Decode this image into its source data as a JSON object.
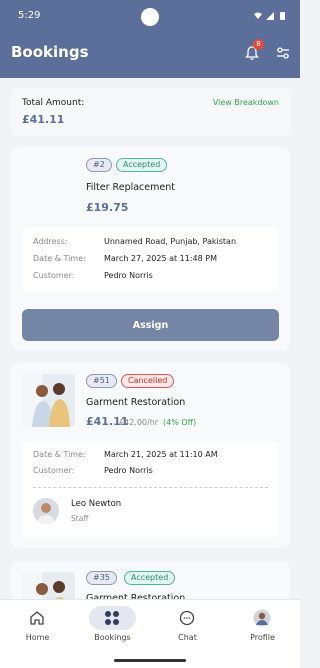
{
  "status": {
    "time": "5:29"
  },
  "header": {
    "title": "Bookings",
    "notification_count": "8"
  },
  "summary": {
    "label": "Total Amount:",
    "value": "£41.11",
    "link": "View Breakdown"
  },
  "bookings": [
    {
      "id": "#2",
      "status": "Accepted",
      "service": "Filter Replacement",
      "price": "£19.75",
      "details": [
        {
          "label": "Address:",
          "value": "Unnamed Road, Punjab, Pakistan"
        },
        {
          "label": "Date & Time:",
          "value": "March 27, 2025 at 11:48 PM"
        },
        {
          "label": "Customer:",
          "value": "Pedro Norris"
        }
      ],
      "action": "Assign"
    },
    {
      "id": "#51",
      "status": "Cancelled",
      "service": "Garment Restoration",
      "price": "£41.11",
      "old_price": "£42.00/hr",
      "discount": "(4% Off)",
      "details": [
        {
          "label": "Date & Time:",
          "value": "March 21, 2025 at 11:10 AM"
        },
        {
          "label": "Customer:",
          "value": "Pedro Norris"
        }
      ],
      "staff": {
        "name": "Leo Newton",
        "role": "Staff"
      }
    },
    {
      "id": "#35",
      "status": "Accepted",
      "service": "Garment Restoration"
    }
  ],
  "nav": [
    {
      "label": "Home",
      "icon": "home-icon"
    },
    {
      "label": "Bookings",
      "icon": "bookings-icon",
      "active": true
    },
    {
      "label": "Chat",
      "icon": "chat-icon"
    },
    {
      "label": "Profile",
      "icon": "profile-avatar"
    }
  ],
  "colors": {
    "primary": "#5b6f9a",
    "accepted": "#2f8c6f",
    "cancelled": "#c62f2f",
    "link_green": "#2fa54a"
  }
}
